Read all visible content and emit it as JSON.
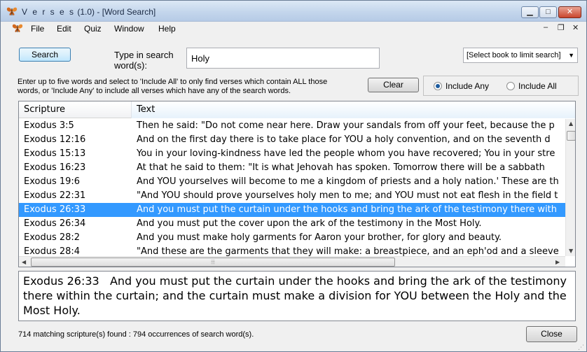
{
  "window": {
    "app_name": "V e r s e s",
    "version": "(1.0)",
    "doc": "[Word Search]",
    "min_glyph": "▁",
    "max_glyph": "□",
    "close_glyph": "✕"
  },
  "menu": {
    "items": [
      "File",
      "Edit",
      "Quiz",
      "Window",
      "Help"
    ],
    "mdi_min": "–",
    "mdi_restore": "❐",
    "mdi_close": "✕"
  },
  "search": {
    "button": "Search",
    "label": "Type in search word(s):",
    "value": "Holy",
    "book_select": "[Select book to limit search]",
    "help": "Enter up to five words and select to 'Include All' to only find verses which contain ALL those words, or 'Include Any' to include all verses which have any of the search words.",
    "clear": "Clear",
    "include_any": "Include Any",
    "include_all": "Include All",
    "selected_mode": "Include Any"
  },
  "table": {
    "columns": [
      "Scripture",
      "Text"
    ],
    "rows": [
      {
        "ref": "Exodus 3:5",
        "text": "Then he said: \"Do not come near here. Draw your sandals from off your feet, because the p"
      },
      {
        "ref": "Exodus 12:16",
        "text": "And on the first day there is to take place for YOU a holy convention, and on the seventh d"
      },
      {
        "ref": "Exodus 15:13",
        "text": "You in your loving-kindness have led the people whom you have recovered; You in your stre"
      },
      {
        "ref": "Exodus 16:23",
        "text": "At that he said to them: \"It is what Jehovah has spoken. Tomorrow there will be a sabbath"
      },
      {
        "ref": "Exodus 19:6",
        "text": "And YOU yourselves will become to me a kingdom of priests and a holy nation.' These are th"
      },
      {
        "ref": "Exodus 22:31",
        "text": "\"And YOU should prove yourselves holy men to me; and YOU must not eat flesh in the field t"
      },
      {
        "ref": "Exodus 26:33",
        "text": "And you must put the curtain under the hooks and bring the ark of the testimony there with"
      },
      {
        "ref": "Exodus 26:34",
        "text": "And you must put the cover upon the ark of the testimony in the Most Holy."
      },
      {
        "ref": "Exodus 28:2",
        "text": "And you must make holy garments for Aaron your brother, for glory and beauty."
      },
      {
        "ref": "Exodus 28:4",
        "text": "\"And these are the garments that they will make: a breastpiece, and an eph'od and a sleeve"
      }
    ],
    "selected_index": 6
  },
  "detail": {
    "ref": "Exodus 26:33",
    "text": "And you must put the curtain under the hooks and bring the ark of the testimony there within the curtain; and the curtain must make a division for YOU between the Holy and the Most Holy."
  },
  "status": {
    "text": "714 matching scripture(s) found  :  794 occurrences of search word(s)."
  },
  "footer": {
    "close": "Close"
  },
  "colors": {
    "selection": "#3399ff",
    "title_gradient": "#c4d6ec"
  }
}
